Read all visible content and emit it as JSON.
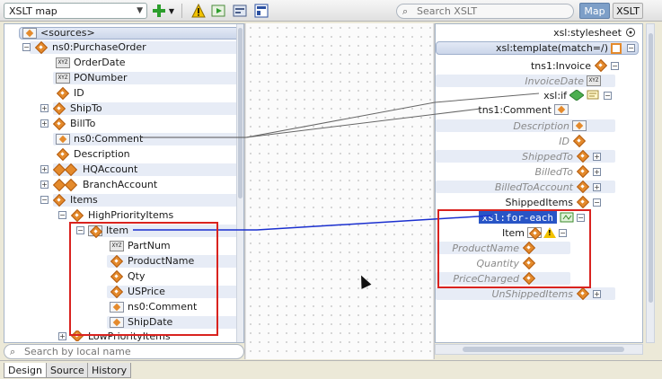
{
  "toolbar": {
    "map_select": "XSLT map",
    "search_placeholder": "Search XSLT",
    "toggle_map": "Map",
    "toggle_xslt": "XSLT"
  },
  "source_tree": [
    {
      "label": "<sources>",
      "kind": "root"
    },
    {
      "label": "ns0:PurchaseOrder",
      "kind": "element"
    },
    {
      "label": "OrderDate",
      "kind": "attribute"
    },
    {
      "label": "PONumber",
      "kind": "text"
    },
    {
      "label": "ID",
      "kind": "element"
    },
    {
      "label": "ShipTo",
      "kind": "element"
    },
    {
      "label": "BillTo",
      "kind": "element"
    },
    {
      "label": "ns0:Comment",
      "kind": "element-box"
    },
    {
      "label": "Description",
      "kind": "element"
    },
    {
      "label": "HQAccount",
      "kind": "element-multi"
    },
    {
      "label": "BranchAccount",
      "kind": "element-multi"
    },
    {
      "label": "Items",
      "kind": "element"
    },
    {
      "label": "HighPriorityItems",
      "kind": "element"
    },
    {
      "label": "Item",
      "kind": "element-repeat"
    },
    {
      "label": "PartNum",
      "kind": "text"
    },
    {
      "label": "ProductName",
      "kind": "element"
    },
    {
      "label": "Qty",
      "kind": "element"
    },
    {
      "label": "USPrice",
      "kind": "element"
    },
    {
      "label": "ns0:Comment",
      "kind": "element-box"
    },
    {
      "label": "ShipDate",
      "kind": "element-box"
    },
    {
      "label": "LowPriorityItems",
      "kind": "element"
    }
  ],
  "target_tree": [
    {
      "label": "xsl:stylesheet",
      "optional": false
    },
    {
      "label": "xsl:template(match=/)",
      "optional": false
    },
    {
      "label": "tns1:Invoice",
      "optional": false
    },
    {
      "label": "InvoiceDate",
      "optional": true
    },
    {
      "label": "xsl:if",
      "optional": false
    },
    {
      "label": "tns1:Comment",
      "optional": false
    },
    {
      "label": "Description",
      "optional": true
    },
    {
      "label": "ID",
      "optional": true
    },
    {
      "label": "ShippedTo",
      "optional": true
    },
    {
      "label": "BilledTo",
      "optional": true
    },
    {
      "label": "BilledToAccount",
      "optional": true
    },
    {
      "label": "ShippedItems",
      "optional": false
    },
    {
      "label": "xsl:for-each",
      "optional": false
    },
    {
      "label": "Item",
      "optional": false
    },
    {
      "label": "ProductName",
      "optional": true
    },
    {
      "label": "Quantity",
      "optional": true
    },
    {
      "label": "PriceCharged",
      "optional": true
    },
    {
      "label": "UnShippedItems",
      "optional": true
    }
  ],
  "source_search_placeholder": "Search by local name",
  "bottom_tabs": [
    "Design",
    "Source",
    "History"
  ],
  "xyz_label": "XYZ",
  "expand_glyph": "+",
  "collapse_glyph": "−",
  "search_glyph": "⌕"
}
